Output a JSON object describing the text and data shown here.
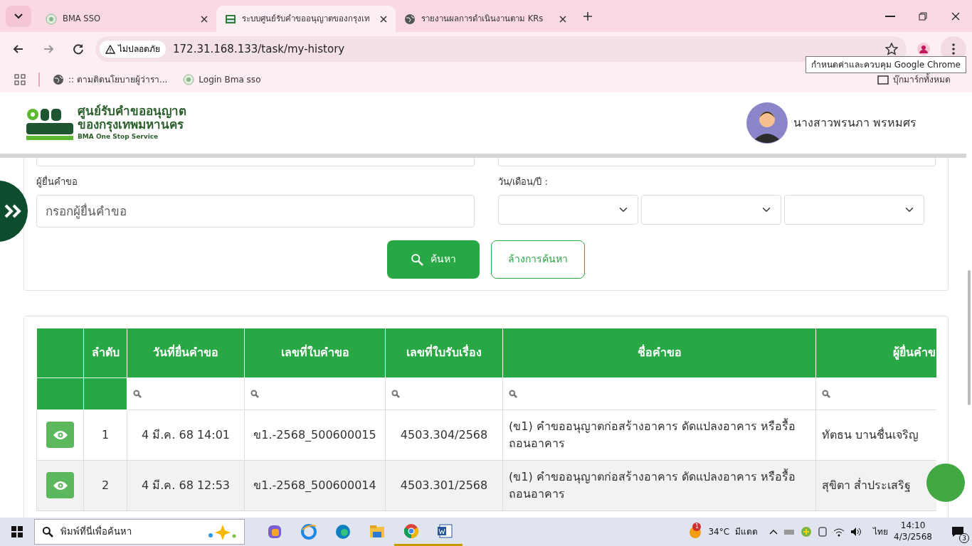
{
  "browser": {
    "tabs": [
      {
        "title": "BMA SSO",
        "selected": false,
        "kind": "sso"
      },
      {
        "title": "ระบบศูนย์รับคำขออนุญาตของกรุงเท",
        "selected": true,
        "kind": "onestop"
      },
      {
        "title": "รายงานผลการดำเนินงานตาม KRs",
        "selected": false,
        "kind": "globe"
      }
    ],
    "security_chip": "ไม่ปลอดภัย",
    "url": "172.31.168.133/task/my-history",
    "bookmarks": [
      {
        "title": ":: ตามติดนโยบายผู้ว่ารา...",
        "kind": "globe"
      },
      {
        "title": "Login Bma sso",
        "kind": "sso"
      }
    ],
    "all_bookmarks": "บุ๊กมาร์กทั้งหมด",
    "tooltip": "กำหนดค่าและควบคุม Google Chrome"
  },
  "header": {
    "logo_line1": "ศูนย์รับคำขออนุญาต",
    "logo_line2": "ของกรุงเทพมหานคร",
    "logo_line3": "BMA One Stop Service",
    "user_name": "นางสาวพรนภา พรหมศร"
  },
  "form": {
    "applicant_label": "ผู้ยื่นคำขอ",
    "applicant_placeholder": "กรอกผู้ยื่นคำขอ",
    "date_label": "วัน/เดือน/ปี :",
    "search_button": "ค้นหา",
    "clear_button": "ล้างการค้นหา"
  },
  "table": {
    "columns": [
      "",
      "ลำดับ",
      "วันที่ยื่นคำขอ",
      "เลขที่ใบคำขอ",
      "เลขที่ใบรับเรื่อง",
      "ชื่อคำขอ",
      "ผู้ยื่นคำข"
    ],
    "filters": [
      false,
      false,
      true,
      true,
      true,
      true,
      true
    ],
    "rows": [
      {
        "no": "1",
        "date": "4 มี.ค. 68 14:01",
        "request_no": "ข1.-2568_500600015",
        "receipt_no": "4503.304/2568",
        "name": "(ข1) คำขออนุญาตก่อสร้างอาคาร ดัดแปลงอาคาร หรือรื้อถอนอาคาร",
        "applicant": "ทัตธน บานชื่นเจริญ"
      },
      {
        "no": "2",
        "date": "4 มี.ค. 68 12:53",
        "request_no": "ข1.-2568_500600014",
        "receipt_no": "4503.301/2568",
        "name": "(ข1) คำขออนุญาตก่อสร้างอาคาร ดัดแปลงอาคาร หรือรื้อถอนอาคาร",
        "applicant": "สุขิตา ส่ำประเสริฐ"
      }
    ]
  },
  "taskbar": {
    "search_placeholder": "พิมพ์ที่นี่เพื่อค้นหา",
    "apps": [
      {
        "kind": "copilot",
        "running": false
      },
      {
        "kind": "ie",
        "running": false
      },
      {
        "kind": "edge",
        "running": false
      },
      {
        "kind": "folder",
        "running": false
      },
      {
        "kind": "chrome",
        "running": true
      },
      {
        "kind": "word",
        "running": true
      }
    ],
    "weather_badge": "1",
    "temperature": "34°C",
    "weather": "มีแดด",
    "language": "ไทย",
    "time": "14:10",
    "date": "4/3/2568",
    "notifications": "3"
  }
}
